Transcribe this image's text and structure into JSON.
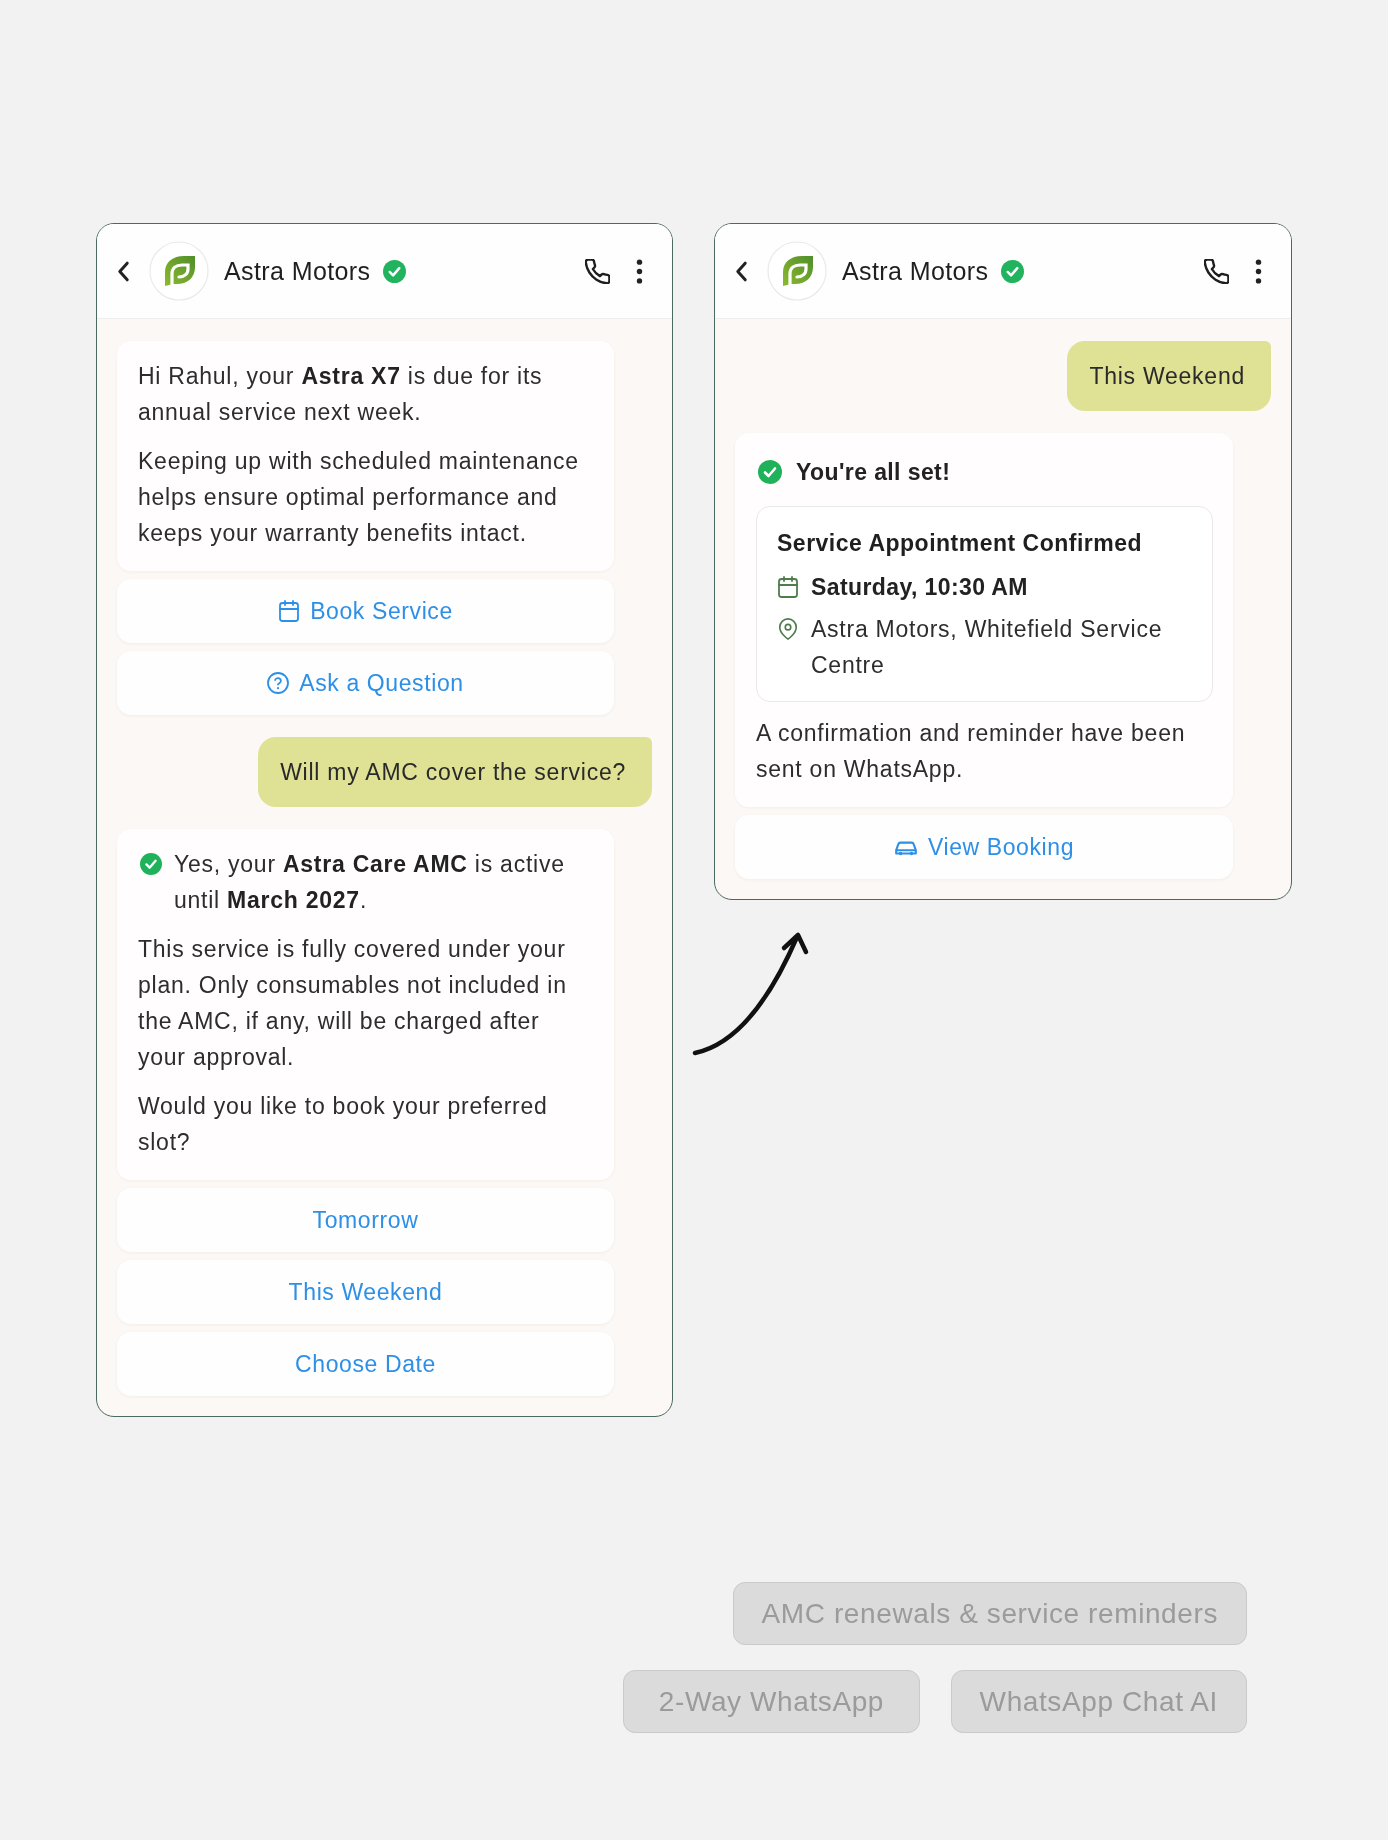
{
  "phones": [
    {
      "header": {
        "title": "Astra Motors",
        "verified": true
      },
      "messages": [
        {
          "kind": "bot",
          "paragraphs": [
            "Hi Rahul, your **Astra X7** is due for its annual service next week.",
            "Keeping up with scheduled maintenance helps ensure optimal performance and keeps your warranty benefits intact."
          ]
        },
        {
          "kind": "reply",
          "label": "Book Service"
        },
        {
          "kind": "reply",
          "label": "Ask a Question"
        },
        {
          "kind": "user",
          "text": "Will my AMC cover the service?"
        },
        {
          "kind": "bot",
          "status": "Yes, your **Astra Care AMC** is active until **March 2027**.",
          "paragraphs": [
            "This service is fully covered under your plan. Only consumables not included in the AMC, if any, will be charged after your approval.",
            "Would you like to book your preferred slot?"
          ]
        },
        {
          "kind": "reply",
          "label": "Tomorrow"
        },
        {
          "kind": "reply",
          "label": "This Weekend"
        },
        {
          "kind": "reply",
          "label": "Choose Date"
        }
      ]
    },
    {
      "header": {
        "title": "Astra Motors",
        "verified": true
      },
      "messages": [
        {
          "kind": "user",
          "text": "This Weekend"
        },
        {
          "kind": "bot",
          "heading": "You're all set!",
          "card": {
            "title": "Service Appointment Confirmed",
            "time": "Saturday, 10:30 AM",
            "location": "Astra Motors, Whitefield Service Centre"
          },
          "paragraphs": [
            "A confirmation and reminder have been sent on WhatsApp."
          ]
        },
        {
          "kind": "reply",
          "label": "View Booking"
        }
      ]
    }
  ],
  "tags": [
    "AMC renewals & service reminders",
    "2-Way WhatsApp",
    "WhatsApp Chat AI"
  ]
}
